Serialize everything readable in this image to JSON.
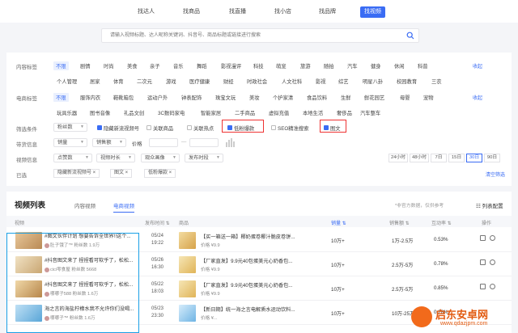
{
  "top_tabs": [
    "找达人",
    "找商品",
    "找直播",
    "找小店",
    "找品牌",
    "找视频"
  ],
  "top_active": "找视频",
  "search": {
    "placeholder": "请输入视频标题、达人昵称关键词、抖音号、商品标题或链接进行搜索"
  },
  "content_tags": {
    "label": "内容标签",
    "row1": [
      "不限",
      "剧情",
      "时尚",
      "美食",
      "亲子",
      "音乐",
      "舞蹈",
      "影视漫评",
      "科技",
      "萌宠",
      "旅游",
      "随拍",
      "汽车",
      "健身",
      "休闲",
      "科普"
    ],
    "row2": [
      "个人管理",
      "居家",
      "体育",
      "二次元",
      "游戏",
      "医疗健康",
      "财经",
      "时政社会",
      "人文社科",
      "影视",
      "综艺",
      "明星八卦",
      "校园教育",
      "三农"
    ],
    "fold": "收起"
  },
  "ecom_tags": {
    "label": "电商标签",
    "row1": [
      "不限",
      "服饰内衣",
      "鞋靴箱包",
      "运动户外",
      "钟表配饰",
      "珠宝文玩",
      "美妆",
      "个护家清",
      "食品饮料",
      "生鲜",
      "鲜花园艺",
      "母婴",
      "宠物"
    ],
    "row2": [
      "玩具乐器",
      "图书音像",
      "礼品文创",
      "3C数码家电",
      "智能家居",
      "二手商品",
      "虚拟充值",
      "本地生活",
      "奢侈品",
      "汽车整车"
    ],
    "fold": "收起"
  },
  "filters": {
    "label": "筛选条件",
    "fans": "粉丝数",
    "hide_new": "隐藏新流视频号",
    "assoc_product": "关联商品",
    "assoc_hot": "关联热点",
    "low_fans": "低粉爆款",
    "seo": "SEO精准搜索",
    "image_text": "图文"
  },
  "goods_info": {
    "label": "带货信息",
    "sales": "销量",
    "sales_amount": "销售额",
    "price": "价格"
  },
  "video_info": {
    "label": "视频信息",
    "likes": "点赞数",
    "duration": "视频时长",
    "audience": "观众画像",
    "publish_time": "发布时段",
    "days": [
      "24小时",
      "48小时",
      "7日",
      "15日",
      "30日",
      "90日"
    ],
    "active_day": "30日"
  },
  "selected": {
    "label": "已选",
    "tags": [
      "隐藏新流视频号 ×",
      "图文 ×",
      "低粉爆款 ×"
    ],
    "clear": "清空筛选"
  },
  "list": {
    "title": "视频列表",
    "tabs": [
      "内容视频",
      "电商视频"
    ],
    "active_tab": "电商视频",
    "note": "*非官方数据，仅供参考",
    "config": "列表配置",
    "columns": [
      "视频",
      "发布时间",
      "商品",
      "销量",
      "销售额",
      "互动率",
      "操作"
    ],
    "rows": [
      {
        "title": "#图文伙伴计划 想要告诉全世界!!这个...",
        "author": "肚子饿了™ 粉丝数 1.9万",
        "date": "05/24",
        "time": "19:22",
        "product": "【买一箱送一箱】椰奶蛋卷椰汁脆皮卷饼...",
        "price": "价格 ¥9.9",
        "sales": "10万+",
        "amount": "1万-2.5万",
        "rate": "0.53%"
      },
      {
        "title": "#抖音图文来了 捏捏看可软乎了，松松...",
        "author": "cici零食屋 粉丝数 5668",
        "date": "05/26",
        "time": "16:30",
        "product": "【厂家直发】9.9元40包蛋美元心奶香包...",
        "price": "价格 ¥9.9",
        "sales": "10万+",
        "amount": "2.5万-5万",
        "rate": "0.78%"
      },
      {
        "title": "#抖音图文来了 捏捏看可软乎了，松松...",
        "author": "哪哪子588 粉丝数 1.6万",
        "date": "05/22",
        "time": "18:03",
        "product": "【厂家直发】9.9元40包蛋美元心奶香包...",
        "price": "价格 ¥9.9",
        "sales": "10万+",
        "amount": "2.5万-5万",
        "rate": "0.85%"
      },
      {
        "title": "海之言的海盐柠檬水我不允许你们没喝...",
        "author": "哪哪子™ 粉丝数 1.6万",
        "date": "05/23",
        "time": "23:30",
        "product": "【新日期】统一海之言电解质水运动饮料...",
        "price": "价格 ¥...",
        "sales": "10万+",
        "amount": "10万-25万",
        "rate": "0.28%"
      }
    ]
  },
  "watermark": {
    "title": "启东安卓网",
    "url": "www.qdazjpm.com"
  }
}
